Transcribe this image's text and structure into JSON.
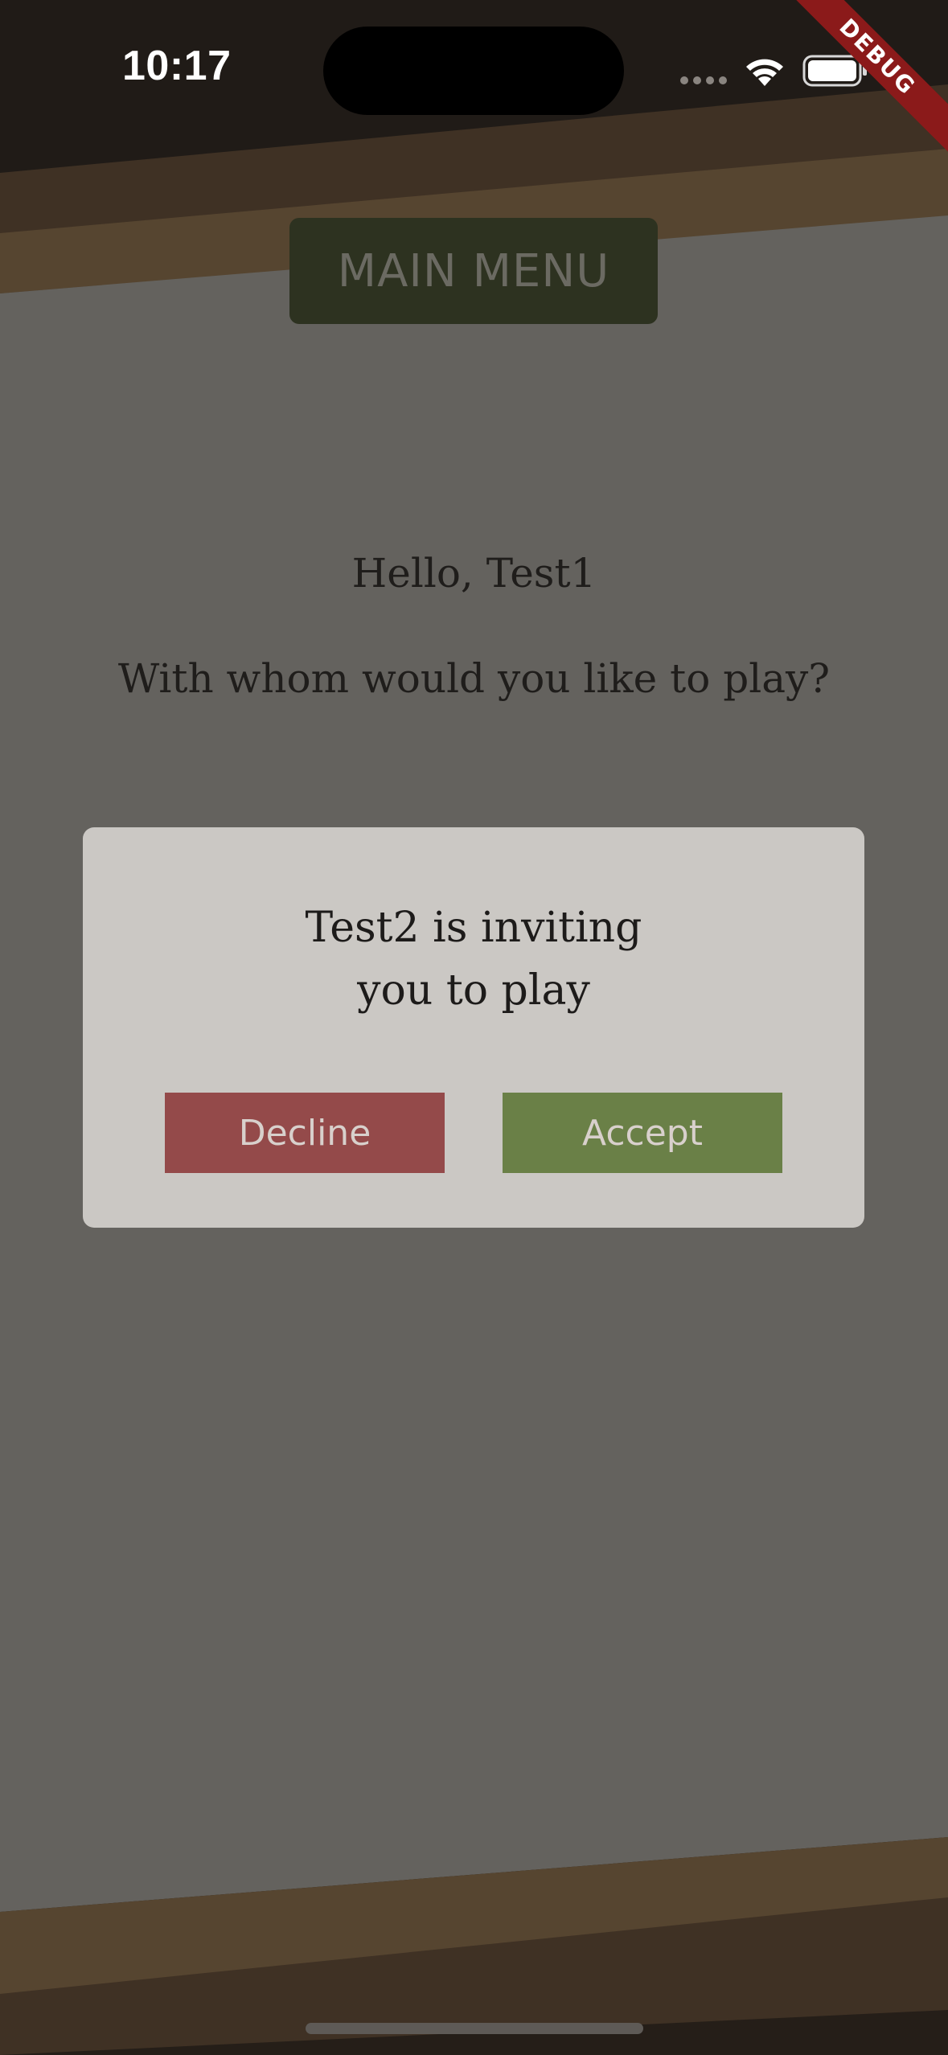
{
  "status_bar": {
    "time": "10:17",
    "icons": [
      "signal-icon",
      "wifi-icon",
      "battery-icon"
    ]
  },
  "debug_banner": "DEBUG",
  "main_menu_label": "MAIN MENU",
  "greeting": "Hello, Test1",
  "question": "With whom would you like to play?",
  "dialog": {
    "message_line1": "Test2 is inviting",
    "message_line2": "you to play",
    "decline_label": "Decline",
    "accept_label": "Accept"
  },
  "colors": {
    "decline": "#944a4a",
    "accept": "#6a8047",
    "main_menu_button": "#2d3220",
    "dialog_bg": "#cbc8c4",
    "overlay_bg": "#64625e"
  }
}
